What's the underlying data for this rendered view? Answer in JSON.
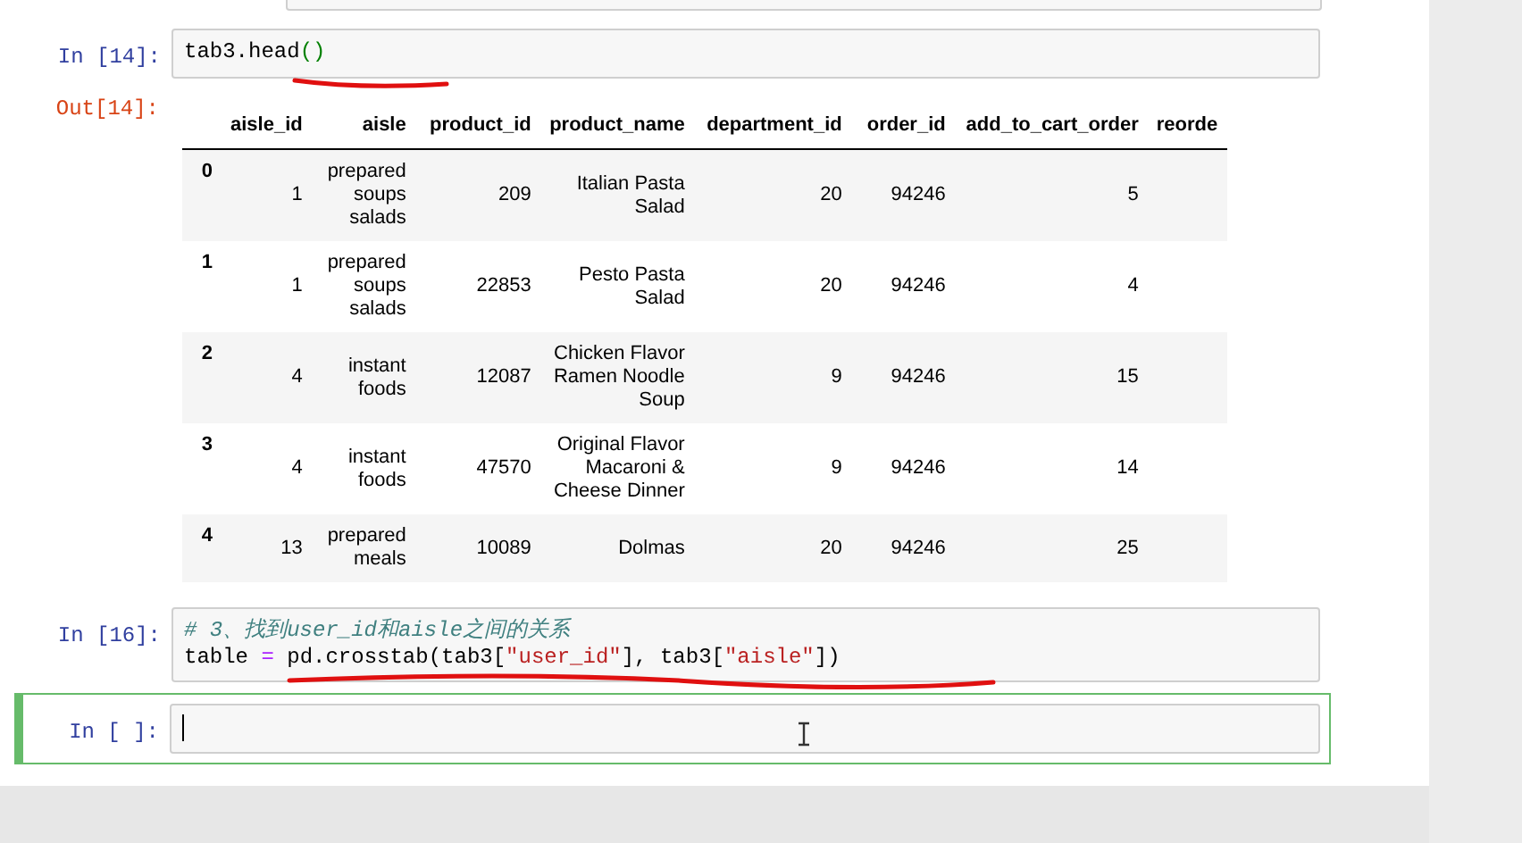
{
  "cells": [
    {
      "kind": "input",
      "prompt": "In [14]:",
      "active": false,
      "lines": [
        [
          {
            "text": "tab3.head",
            "kind": "plain"
          },
          {
            "text": "()",
            "kind": "paren"
          }
        ]
      ]
    },
    {
      "kind": "output",
      "prompt": "Out[14]:",
      "table": {
        "columns": [
          "",
          "aisle_id",
          "aisle",
          "product_id",
          "product_name",
          "department_id",
          "order_id",
          "add_to_cart_order",
          "reorde"
        ],
        "rows": [
          [
            "0",
            "1",
            "prepared soups salads",
            "209",
            "Italian Pasta Salad",
            "20",
            "94246",
            "5",
            ""
          ],
          [
            "1",
            "1",
            "prepared soups salads",
            "22853",
            "Pesto Pasta Salad",
            "20",
            "94246",
            "4",
            ""
          ],
          [
            "2",
            "4",
            "instant foods",
            "12087",
            "Chicken Flavor Ramen Noodle Soup",
            "9",
            "94246",
            "15",
            ""
          ],
          [
            "3",
            "4",
            "instant foods",
            "47570",
            "Original Flavor Macaroni & Cheese Dinner",
            "9",
            "94246",
            "14",
            ""
          ],
          [
            "4",
            "13",
            "prepared meals",
            "10089",
            "Dolmas",
            "20",
            "94246",
            "25",
            ""
          ]
        ]
      }
    },
    {
      "kind": "input",
      "prompt": "In [16]:",
      "active": false,
      "lines": [
        [
          {
            "text": "# 3、找到user_id和aisle之间的关系",
            "kind": "comment"
          }
        ],
        [
          {
            "text": "table ",
            "kind": "plain"
          },
          {
            "text": "=",
            "kind": "operator"
          },
          {
            "text": " pd.crosstab(tab3[",
            "kind": "plain"
          },
          {
            "text": "\"user_id\"",
            "kind": "string"
          },
          {
            "text": "], tab3[",
            "kind": "plain"
          },
          {
            "text": "\"aisle\"",
            "kind": "string"
          },
          {
            "text": "])",
            "kind": "plain"
          }
        ]
      ]
    },
    {
      "kind": "input",
      "prompt": "In [ ]:",
      "active": true
    }
  ]
}
